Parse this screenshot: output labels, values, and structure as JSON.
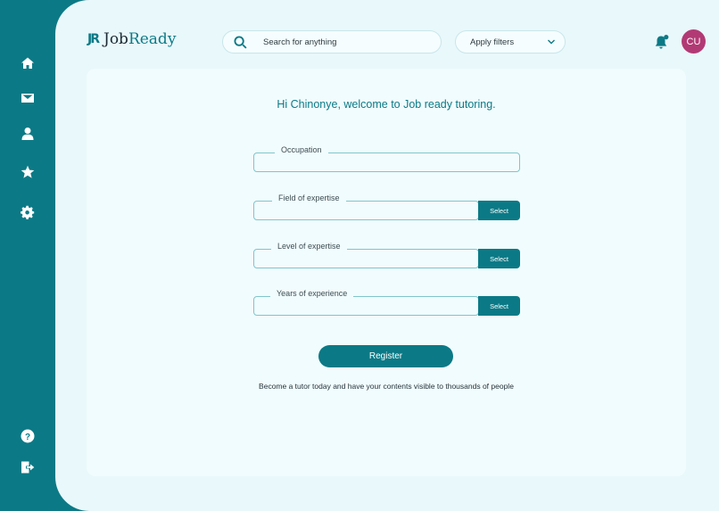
{
  "brand": {
    "logo_mark": "JR",
    "name_prefix": "Job",
    "name_suffix": "Ready"
  },
  "search": {
    "placeholder": "Search for anything",
    "icon": "search-icon"
  },
  "filters": {
    "label": "Apply filters",
    "icon": "chevron-down-icon"
  },
  "user": {
    "initials": "CU",
    "avatar_color": "#b23a74"
  },
  "sidebar": {
    "top_items": [
      {
        "name": "home",
        "icon": "home-icon"
      },
      {
        "name": "messages",
        "icon": "mail-icon"
      },
      {
        "name": "profile",
        "icon": "user-icon"
      },
      {
        "name": "favorites",
        "icon": "star-icon"
      },
      {
        "name": "settings",
        "icon": "gear-icon"
      }
    ],
    "bottom_items": [
      {
        "name": "help",
        "icon": "help-icon"
      },
      {
        "name": "logout",
        "icon": "logout-icon"
      }
    ]
  },
  "form": {
    "greeting": "Hi Chinonye, welcome to Job ready tutoring.",
    "fields": [
      {
        "label": "Occupation",
        "value": "",
        "has_select": false
      },
      {
        "label": "Field of expertise",
        "value": "",
        "has_select": true,
        "select_label": "Select"
      },
      {
        "label": "Level of expertise",
        "value": "",
        "has_select": true,
        "select_label": "Select"
      },
      {
        "label": "Years of experience",
        "value": "",
        "has_select": true,
        "select_label": "Select"
      }
    ],
    "register_label": "Register",
    "note": "Become a tutor today and have your contents visible to thousands of people"
  },
  "colors": {
    "primary": "#0b7a86",
    "background": "#e9f8fb",
    "card": "#f1fcfe"
  }
}
